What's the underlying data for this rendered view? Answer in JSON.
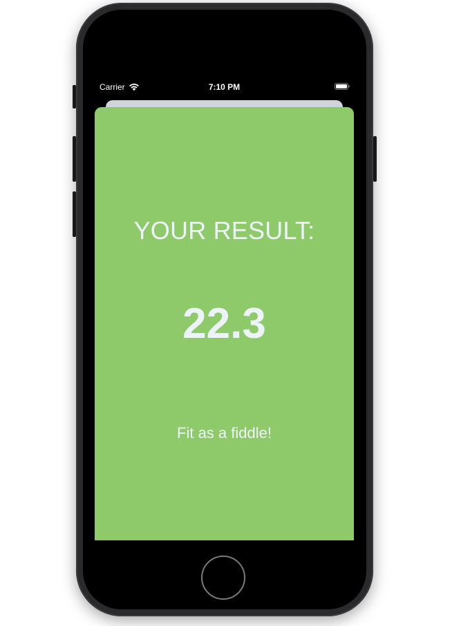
{
  "status_bar": {
    "carrier": "Carrier",
    "time": "7:10 PM",
    "wifi_icon": "wifi-icon",
    "battery_icon": "battery-icon"
  },
  "result": {
    "title": "YOUR RESULT:",
    "value": "22.3",
    "message": "Fit as a fiddle!"
  },
  "colors": {
    "sheet_background": "#8fca6a",
    "text": "#eef3fb",
    "back_card": "#cfd5d8"
  }
}
